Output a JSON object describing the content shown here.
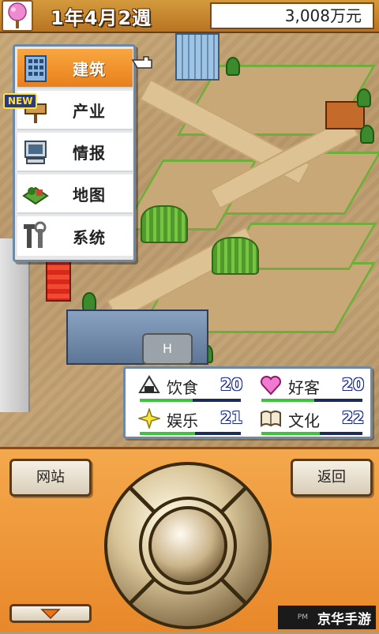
{
  "header": {
    "date": "1年4月2週",
    "money": "3,008万元"
  },
  "menu": {
    "new_badge": "NEW",
    "items": [
      {
        "label": "建筑",
        "icon": "building-icon",
        "selected": true
      },
      {
        "label": "产业",
        "icon": "signpost-icon",
        "selected": false
      },
      {
        "label": "情报",
        "icon": "computer-icon",
        "selected": false
      },
      {
        "label": "地图",
        "icon": "map-icon",
        "selected": false
      },
      {
        "label": "系统",
        "icon": "tools-icon",
        "selected": false
      }
    ]
  },
  "stats": {
    "items": [
      {
        "label": "饮食",
        "value": "20",
        "icon": "rice-ball-icon",
        "level": 0.52
      },
      {
        "label": "好客",
        "value": "20",
        "icon": "heart-icon",
        "level": 0.52
      },
      {
        "label": "娱乐",
        "value": "21",
        "icon": "sparkle-icon",
        "level": 0.55
      },
      {
        "label": "文化",
        "value": "22",
        "icon": "book-icon",
        "level": 0.58
      }
    ]
  },
  "controls": {
    "website_label": "网站",
    "back_label": "返回"
  },
  "watermark": {
    "pm": "PM",
    "text": "京华手游"
  },
  "map": {
    "heliport_label": "H"
  }
}
